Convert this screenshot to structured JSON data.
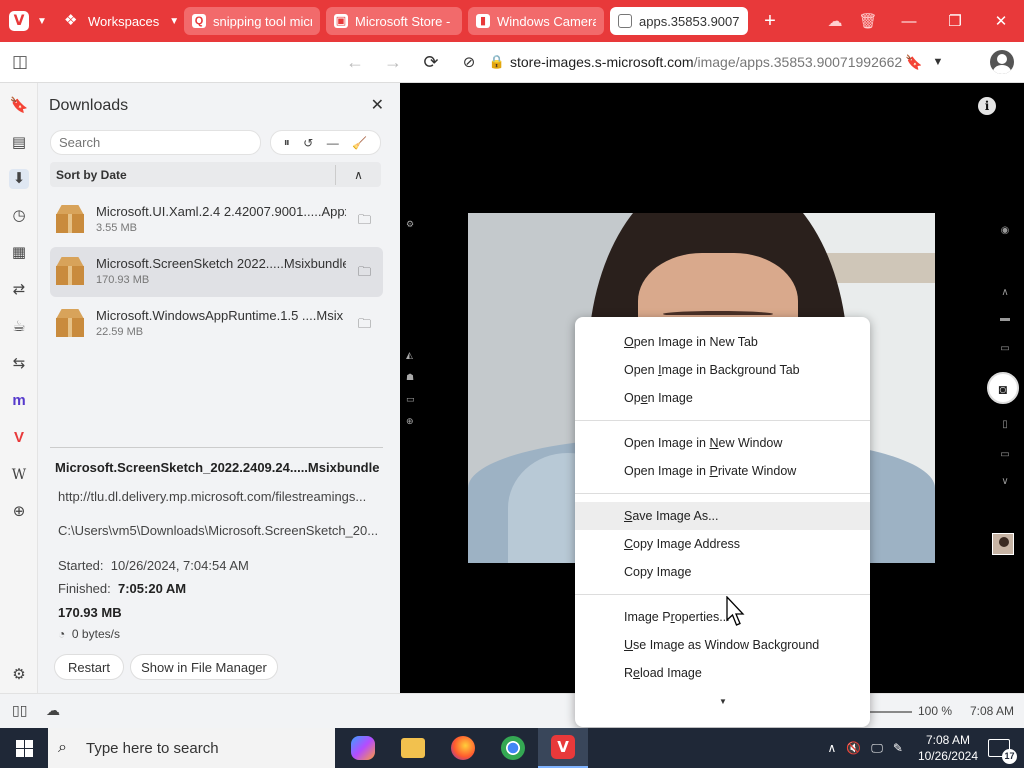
{
  "browser": {
    "workspaces_label": "Workspaces",
    "tabs": [
      {
        "title": "snipping tool micros",
        "fav_color": "#e8393a",
        "fav_glyph": "Q"
      },
      {
        "title": "Microsoft Store - Ge",
        "fav_color": "#e8393a",
        "fav_glyph": "M"
      },
      {
        "title": "Windows Camera - M",
        "fav_color": "#e8393a",
        "fav_glyph": "W"
      },
      {
        "title": "apps.35853.9007199",
        "fav_color": "#ffffff",
        "fav_glyph": ""
      }
    ],
    "url_domain": "store-images.s-microsoft.com",
    "url_path": "/image/apps.35853.90071992662527...",
    "accent_color": "#e8393a"
  },
  "downloads": {
    "title": "Downloads",
    "search_placeholder": "Search",
    "sort_label": "Sort by Date",
    "items": [
      {
        "name": "Microsoft.UI.Xaml.2.4  2.42007.9001.....Appx",
        "size": "3.55 MB"
      },
      {
        "name": "Microsoft.ScreenSketch  2022.....Msixbundle",
        "size": "170.93 MB"
      },
      {
        "name": "Microsoft.WindowsAppRuntime.1.5  ....Msix",
        "size": "22.59 MB"
      }
    ],
    "details": {
      "name": "Microsoft.ScreenSketch_2022.2409.24.....Msixbundle",
      "url": "http://tlu.dl.delivery.mp.microsoft.com/filestreamings...",
      "path": "C:\\Users\\vm5\\Downloads\\Microsoft.ScreenSketch_20...",
      "started_label": "Started:",
      "started_value": "10/26/2024, 7:04:54 AM",
      "finished_label": "Finished:",
      "finished_value": "7:05:20 AM",
      "size": "170.93 MB",
      "speed": "0 bytes/s",
      "restart_label": "Restart",
      "show_label": "Show in File Manager"
    }
  },
  "context_menu": {
    "items": [
      {
        "pre": "",
        "u": "O",
        "post": "pen Image in New Tab"
      },
      {
        "pre": "Open ",
        "u": "I",
        "post": "mage in Background Tab"
      },
      {
        "pre": "Op",
        "u": "e",
        "post": "n Image"
      },
      {
        "pre": "Open Image in ",
        "u": "N",
        "post": "ew Window"
      },
      {
        "pre": "Open Image in ",
        "u": "P",
        "post": "rivate Window"
      },
      {
        "pre": "",
        "u": "S",
        "post": "ave Image As..."
      },
      {
        "pre": "",
        "u": "C",
        "post": "opy Image Address"
      },
      {
        "pre": "Copy Ima",
        "u": "g",
        "post": "e"
      },
      {
        "pre": "Image P",
        "u": "r",
        "post": "operties..."
      },
      {
        "pre": "",
        "u": "U",
        "post": "se Image as Window Background"
      },
      {
        "pre": "R",
        "u": "e",
        "post": "load Image"
      }
    ]
  },
  "statusbar": {
    "zoom": "100 %",
    "clock": "7:08 AM"
  },
  "taskbar": {
    "search_placeholder": "Type here to search",
    "time": "7:08 AM",
    "date": "10/26/2024",
    "notifications": "17"
  }
}
